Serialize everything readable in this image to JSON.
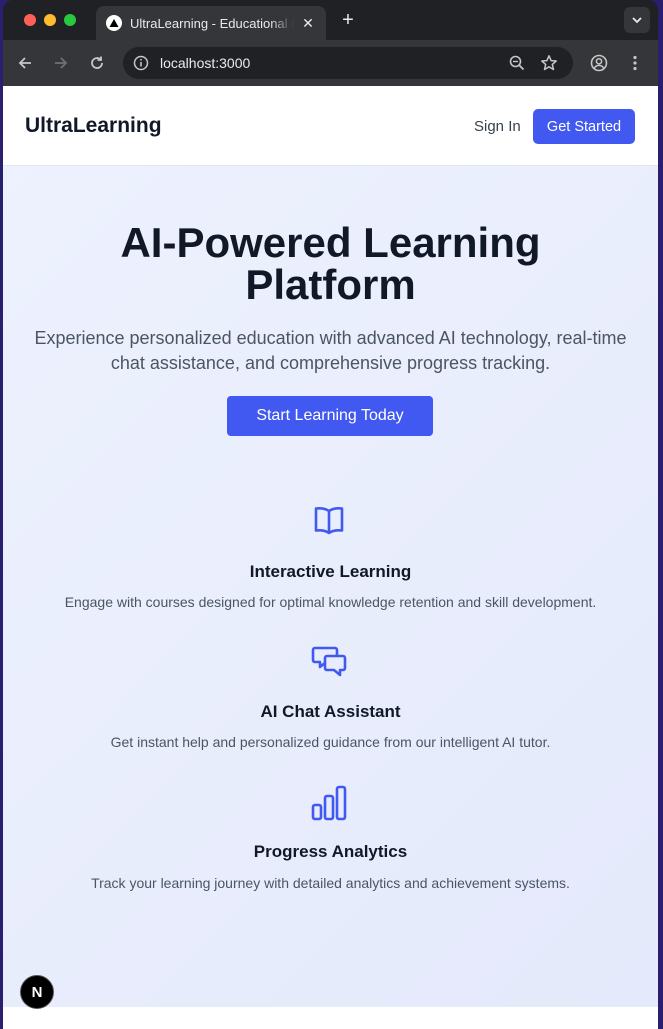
{
  "browser": {
    "tab_title": "UltraLearning - Educational Platform",
    "url": "localhost:3000"
  },
  "header": {
    "brand": "UltraLearning",
    "sign_in": "Sign In",
    "get_started": "Get Started"
  },
  "hero": {
    "title_line1": "AI-Powered Learning",
    "title_line2": "Platform",
    "subtitle_line1": "Experience personalized education with advanced AI technology, real-time",
    "subtitle_line2": "chat assistance, and comprehensive progress tracking.",
    "cta": "Start Learning Today"
  },
  "features": [
    {
      "icon": "book-open-icon",
      "title": "Interactive Learning",
      "description": "Engage with courses designed for optimal knowledge retention and skill development."
    },
    {
      "icon": "chat-bubbles-icon",
      "title": "AI Chat Assistant",
      "description": "Get instant help and personalized guidance from our intelligent AI tutor."
    },
    {
      "icon": "bar-chart-icon",
      "title": "Progress Analytics",
      "description": "Track your learning journey with detailed analytics and achievement systems."
    }
  ],
  "dev_badge": "N",
  "colors": {
    "accent": "#4159f0",
    "heading": "#111827",
    "body_text": "#4b5563"
  }
}
